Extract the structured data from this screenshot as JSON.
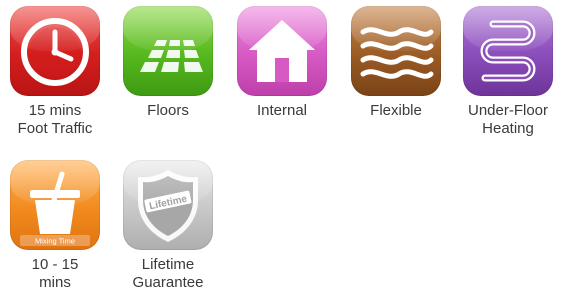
{
  "features": [
    {
      "icon": "clock-icon",
      "lines": [
        "15 mins",
        "Foot Traffic"
      ],
      "color": "#d41e1e"
    },
    {
      "icon": "floor-tiles-icon",
      "lines": [
        "Floors"
      ],
      "color": "#56b81f"
    },
    {
      "icon": "house-icon",
      "lines": [
        "Internal"
      ],
      "color": "#d659c4"
    },
    {
      "icon": "wavy-lines-icon",
      "lines": [
        "Flexible"
      ],
      "color": "#9a5b24"
    },
    {
      "icon": "heating-coil-icon",
      "lines": [
        "Under-Floor",
        "Heating"
      ],
      "color": "#8a4dbb"
    },
    {
      "icon": "mixing-bucket-icon",
      "lines": [
        "10 - 15",
        "mins"
      ],
      "color": "#f28a1e",
      "icon_text": "Mixing Time"
    },
    {
      "icon": "shield-icon",
      "lines": [
        "Lifetime",
        "Guarantee"
      ],
      "color": "#c8c8c8",
      "icon_text": "Lifetime"
    }
  ]
}
